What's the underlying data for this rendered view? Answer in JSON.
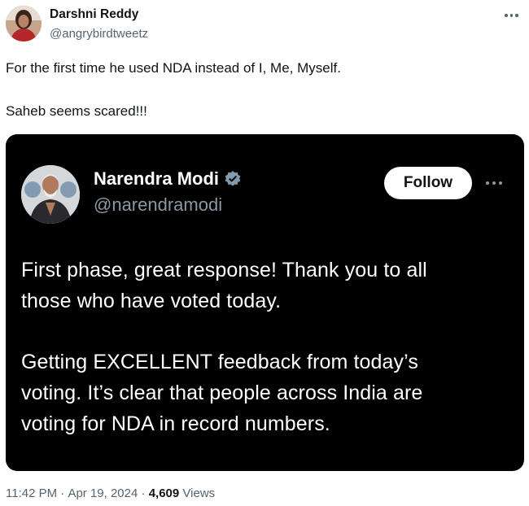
{
  "author": {
    "name": "Darshni Reddy",
    "handle": "@angrybirdtweetz"
  },
  "tweet_text": {
    "line1": "For the first time he used NDA instead of I, Me, Myself.",
    "line2": "Saheb seems scared!!!"
  },
  "quoted": {
    "name": "Narendra Modi",
    "handle": "@narendramodi",
    "follow_label": "Follow",
    "verified_icon": "verified-badge-icon",
    "lines": [
      "First phase, great response! Thank you to all",
      "those who have voted today.",
      "Getting EXCELLENT feedback from today’s",
      "voting. It’s clear that people across India are",
      "voting for NDA in record numbers."
    ]
  },
  "meta": {
    "time": "11:42 PM",
    "separator": " · ",
    "date": "Apr 19, 2024",
    "views_count": "4,609",
    "views_label": "Views"
  },
  "colors": {
    "embed_bg": "#000000",
    "verified": "#829aab",
    "secondary_text": "#536471"
  }
}
